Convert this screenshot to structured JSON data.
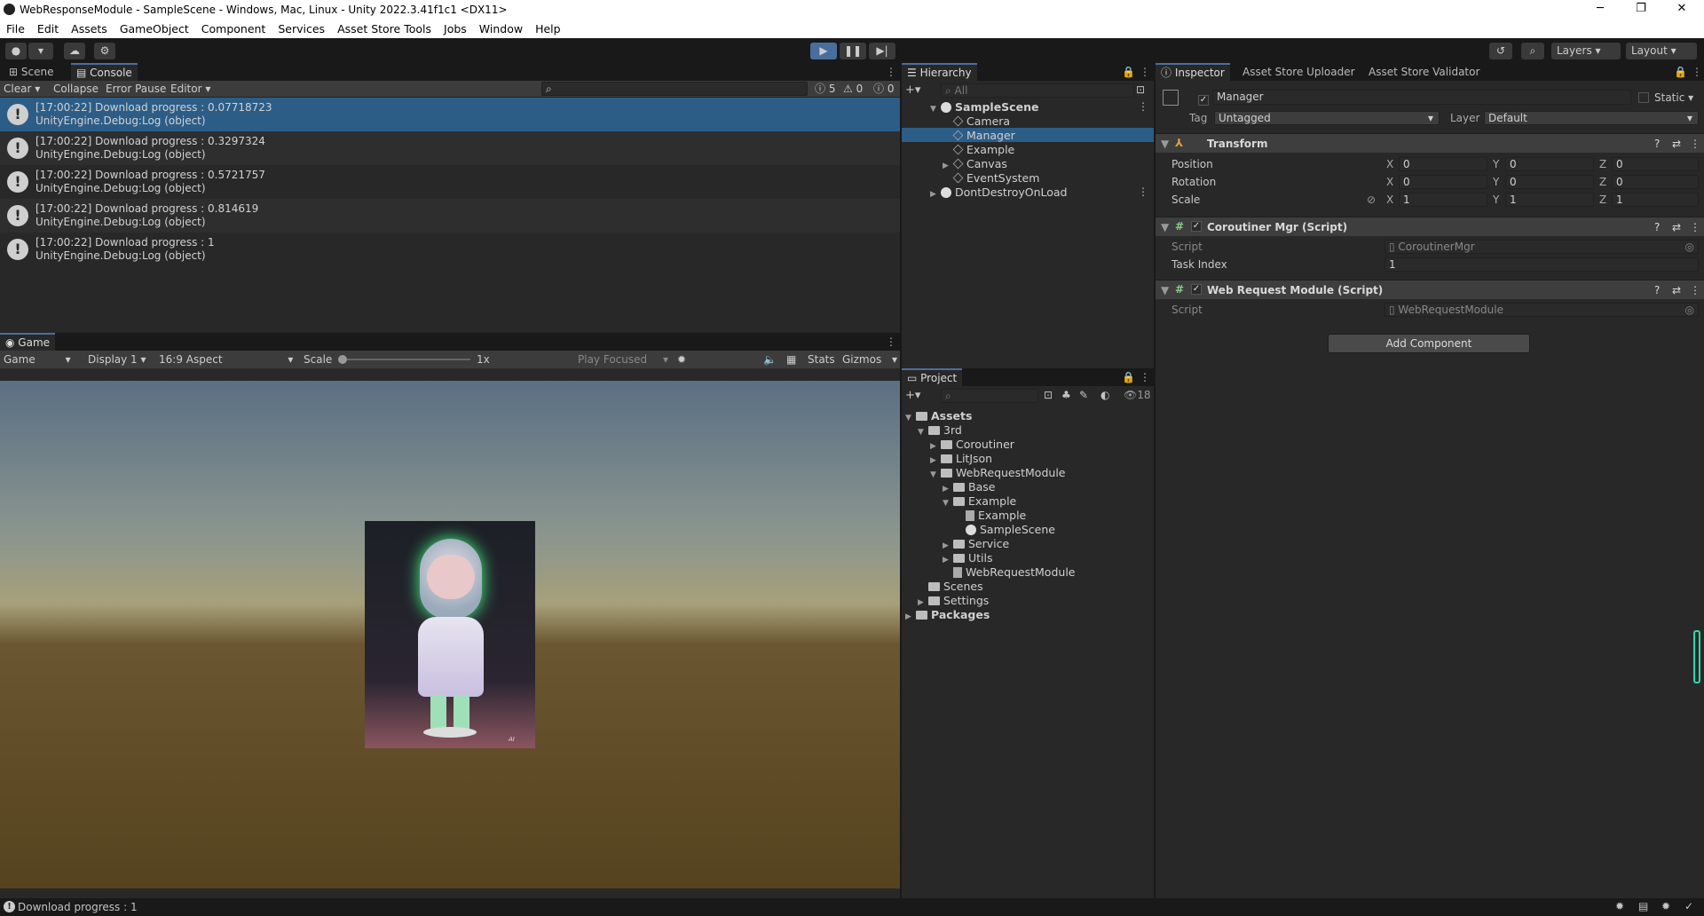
{
  "window": {
    "title": "WebResponseModule - SampleScene - Windows, Mac, Linux - Unity 2022.3.41f1c1 <DX11>"
  },
  "menu": [
    "File",
    "Edit",
    "Assets",
    "GameObject",
    "Component",
    "Services",
    "Asset Store Tools",
    "Jobs",
    "Window",
    "Help"
  ],
  "toolbar": {
    "layers": "Layers",
    "layout": "Layout"
  },
  "console": {
    "tabs": [
      "Scene",
      "Console"
    ],
    "buttons": {
      "clear": "Clear",
      "collapse": "Collapse",
      "error_pause": "Error Pause",
      "editor": "Editor"
    },
    "counts": {
      "logs": "5",
      "warnings": "0",
      "errors": "0"
    },
    "entries": [
      {
        "line1": "[17:00:22] Download progress : 0.07718723",
        "line2": "UnityEngine.Debug:Log (object)"
      },
      {
        "line1": "[17:00:22] Download progress : 0.3297324",
        "line2": "UnityEngine.Debug:Log (object)"
      },
      {
        "line1": "[17:00:22] Download progress : 0.5721757",
        "line2": "UnityEngine.Debug:Log (object)"
      },
      {
        "line1": "[17:00:22] Download progress : 0.814619",
        "line2": "UnityEngine.Debug:Log (object)"
      },
      {
        "line1": "[17:00:22] Download progress : 1",
        "line2": "UnityEngine.Debug:Log (object)"
      }
    ]
  },
  "game": {
    "tab": "Game",
    "mode": "Game",
    "display": "Display 1",
    "aspect": "16:9 Aspect",
    "scale_label": "Scale",
    "scale_value": "1x",
    "play_focused": "Play Focused",
    "stats": "Stats",
    "gizmos": "Gizmos",
    "image_caption": "AI"
  },
  "hierarchy": {
    "tab": "Hierarchy",
    "search_placeholder": "All",
    "scene": "SampleScene",
    "items": [
      "Camera",
      "Manager",
      "Example",
      "Canvas",
      "EventSystem"
    ],
    "dontdestroy": "DontDestroyOnLoad"
  },
  "project": {
    "tab": "Project",
    "badge": "18",
    "assets": "Assets",
    "third": "3rd",
    "folders3rd": [
      "Coroutiner",
      "LitJson",
      "WebRequestModule"
    ],
    "wrm": [
      "Base",
      "Example"
    ],
    "example_items": [
      "Example",
      "SampleScene"
    ],
    "wrm_rest": [
      "Service",
      "Utils"
    ],
    "wrm_script": "WebRequestModule",
    "root_rest": [
      "Scenes",
      "Settings"
    ],
    "packages": "Packages"
  },
  "inspector": {
    "tabs": [
      "Inspector",
      "Asset Store Uploader",
      "Asset Store Validator"
    ],
    "object_name": "Manager",
    "static": "Static",
    "tag_label": "Tag",
    "tag": "Untagged",
    "layer_label": "Layer",
    "layer": "Default",
    "transform": {
      "title": "Transform",
      "rows": [
        {
          "label": "Position",
          "x": "0",
          "y": "0",
          "z": "0"
        },
        {
          "label": "Rotation",
          "x": "0",
          "y": "0",
          "z": "0"
        },
        {
          "label": "Scale",
          "x": "1",
          "y": "1",
          "z": "1"
        }
      ]
    },
    "coroutiner": {
      "title": "Coroutiner Mgr (Script)",
      "script_label": "Script",
      "script": "CoroutinerMgr",
      "task_label": "Task Index",
      "task": "1"
    },
    "webreq": {
      "title": "Web Request Module (Script)",
      "script_label": "Script",
      "script": "WebRequestModule"
    },
    "add_component": "Add Component"
  },
  "status": {
    "message": "Download progress : 1"
  }
}
